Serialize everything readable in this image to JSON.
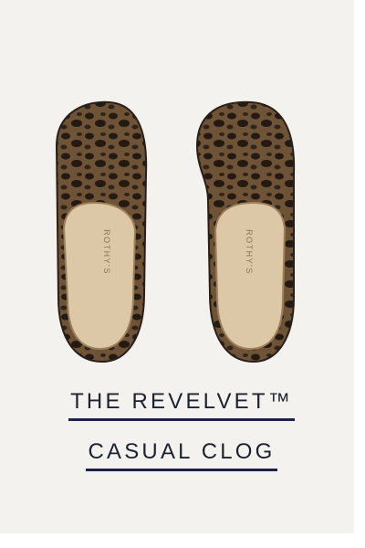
{
  "colors": {
    "card_background": "#f3f2ef",
    "title_text": "#1c2230",
    "underline": "#1b2440",
    "clog_knit_dark": "#2a1f18",
    "clog_knit_light": "#6e5336",
    "footbed": "#dcc7a6"
  },
  "product": {
    "image_alt": "pair of casual clogs, top view",
    "insole_brand": "ROTHY'S",
    "title_line_1": "THE REVELVET™",
    "title_line_2": "CASUAL CLOG"
  }
}
